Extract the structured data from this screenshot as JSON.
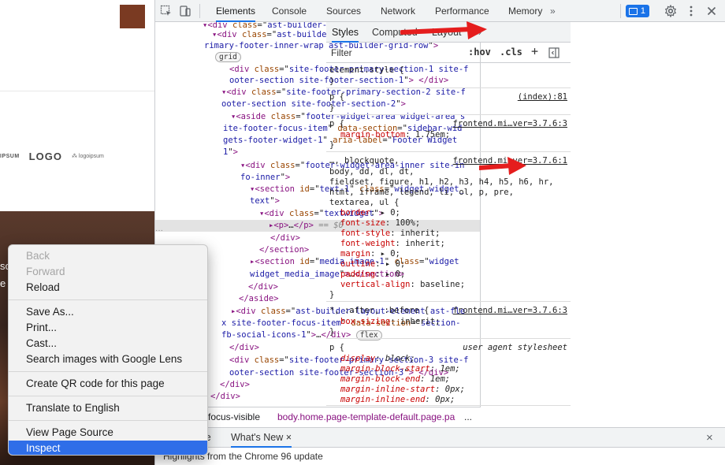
{
  "webpage": {
    "logos": [
      "IPSUM",
      "LOGO",
      "logoipsum"
    ],
    "photo_snippets": [
      "so",
      "e"
    ]
  },
  "context_menu": {
    "groups": [
      [
        {
          "label": "Back",
          "disabled": true
        },
        {
          "label": "Forward",
          "disabled": true
        },
        {
          "label": "Reload"
        }
      ],
      [
        {
          "label": "Save As..."
        },
        {
          "label": "Print..."
        },
        {
          "label": "Cast..."
        },
        {
          "label": "Search images with Google Lens"
        }
      ],
      [
        {
          "label": "Create QR code for this page"
        }
      ],
      [
        {
          "label": "Translate to English"
        }
      ],
      [
        {
          "label": "View Page Source"
        },
        {
          "label": "Inspect",
          "active": true
        }
      ]
    ]
  },
  "devtools": {
    "tabs": [
      "Elements",
      "Console",
      "Sources",
      "Network",
      "Performance",
      "Memory"
    ],
    "more_tabs": "»",
    "issues_count": "1",
    "elements_lines": [
      "<span class='tag'>▾&lt;div</span> <span class='an'>class</span>=\"<span class='av'>ast-builder-grid-row-container-inner</span>\"",
      "<span class='tag'>▾&lt;div</span> <span class='an'>class</span>=\"<span class='av'>ast-builder-footer-grid-columns site-</span>",
      "<span class='av'>rimary-footer-inner-wrap ast-builder-grid-row</span>\"<span class='tag'>&gt;</span>",
      "<span class='pill'>grid</span>",
      "<span class='tag'>&lt;div</span> <span class='an'>class</span>=\"<span class='av'>site-footer-primary-section-1 site-f</span>",
      "<span class='av'>ooter-section site-footer-section-1</span>\"<span class='tag'>&gt;</span> <span class='tag'>&lt;/div&gt;</span>",
      "<span class='tag'>▾&lt;div</span> <span class='an'>class</span>=\"<span class='av'>site-footer-primary-section-2 site-f</span>",
      "<span class='av'>ooter-section site-footer-section-2</span>\"<span class='tag'>&gt;</span>",
      "<span class='tag'>▾&lt;aside</span> <span class='an'>class</span>=\"<span class='av'>footer-widget-area widget-area s</span>",
      "<span class='av'>ite-footer-focus-item</span>\" <span class='an'>data-section</span>=\"<span class='av'>sidebar-wid</span>",
      "<span class='av'>gets-footer-widget-1</span>\" <span class='an'>aria-label</span>=\"<span class='av'>Footer Widget</span>",
      "<span class='av'>1</span>\"<span class='tag'>&gt;</span>",
      "<span class='tag'>▾&lt;div</span> <span class='an'>class</span>=\"<span class='av'>footer-widget-area-inner site-in</span>",
      "<span class='av'>fo-inner</span>\"<span class='tag'>&gt;</span>",
      "<span class='tag'>▾&lt;section</span> <span class='an'>id</span>=\"<span class='av'>text-1</span>\" <span class='an'>class</span>=\"<span class='av'>widget widget_</span>",
      "<span class='av'>text</span>\"<span class='tag'>&gt;</span>",
      "<span class='tag'>▾&lt;div</span> <span class='an'>class</span>=\"<span class='av'>textwidget</span>\"<span class='tag'>&gt;</span>",
      "<span class='tag'>▸&lt;p&gt;</span>…<span class='tag'>&lt;/p&gt;</span> <span class='dim'>==</span> <span class='dim ital'>$0</span>",
      "<span class='tag'>&lt;/div&gt;</span>",
      "<span class='tag'>&lt;/section&gt;</span>",
      "<span class='tag'>▸&lt;section</span> <span class='an'>id</span>=\"<span class='av'>media_image-1</span>\" <span class='an'>class</span>=\"<span class='av'>widget</span>",
      "<span class='av'>widget_media_image</span>\"<span class='tag'>&gt;</span>…<span class='tag'>&lt;/section&gt;</span>",
      "<span class='tag'>&lt;/div&gt;</span>",
      "<span class='tag'>&lt;/aside&gt;</span>",
      "<span class='tag'>▸&lt;div</span> <span class='an'>class</span>=\"<span class='av'>ast-builder-layout-element ast-fle</span>",
      "<span class='av'>x site-footer-focus-item</span>\" <span class='an'>data-section</span>=\"<span class='av'>section-</span>",
      "<span class='av'>fb-social-icons-1</span>\"<span class='tag'>&gt;</span>…<span class='tag'>&lt;/div&gt;</span> <span class='pill'>flex</span>",
      "<span class='tag'>&lt;/div&gt;</span>",
      "<span class='tag'>&lt;div</span> <span class='an'>class</span>=\"<span class='av'>site-footer-primary-section-3 site-f</span>",
      "<span class='av'>ooter-section site-footer-section-3</span>\"<span class='tag'>&gt;</span> <span class='tag'>&lt;/div&gt;</span>",
      "<span class='tag'>&lt;/div&gt;</span>",
      "<span class='tag'>&lt;/div&gt;</span>"
    ],
    "breadcrumbs": [
      "-focus-visible",
      "body.home.page-template-default.page.pa",
      "..."
    ],
    "styles_tabs": [
      "Styles",
      "Computed",
      "Layout",
      "»"
    ],
    "filter_placeholder": "Filter",
    "filter_buttons": [
      ":hov",
      ".cls",
      "+"
    ],
    "rules": [
      {
        "lines": [
          "element.style {",
          "}"
        ]
      },
      {
        "selector": "p {",
        "source": "(index):81",
        "lines": [
          "}"
        ]
      },
      {
        "selector": "p {",
        "source": "frontend.mi…ver=3.7.6:3",
        "decls": [
          [
            "margin-bottom",
            "1.75em;"
          ]
        ],
        "close": "}"
      },
      {
        "selector": "…, blockquote,",
        "source": "frontend.mi…ver=3.7.6:1",
        "sel_lines": [
          "body, dd, dl, dt,",
          "fieldset, figure, h1, h2, h3, h4, h5, h6, hr,",
          "html, iframe, legend, li, ol, p, pre,",
          "textarea, ul {"
        ],
        "decls": [
          [
            "border",
            "▸ 0;"
          ],
          [
            "font-size",
            "100%;"
          ],
          [
            "font-style",
            "inherit;"
          ],
          [
            "font-weight",
            "inherit;"
          ],
          [
            "margin",
            "▸ 0;"
          ],
          [
            "outline",
            "▸ 0;"
          ],
          [
            "padding",
            "▸ 0;"
          ],
          [
            "vertical-align",
            "baseline;"
          ]
        ],
        "close": "}"
      },
      {
        "selector": "*, :after, :before {",
        "source": "frontend.mi…ver=3.7.6:3",
        "decls": [
          [
            "box-sizing",
            "inherit;"
          ]
        ],
        "close": "}"
      },
      {
        "selector": "p {",
        "source": "user agent stylesheet",
        "decls": [
          [
            "display",
            "block;"
          ],
          [
            "margin-block-start",
            "1em;"
          ],
          [
            "margin-block-end",
            "1em;"
          ],
          [
            "margin-inline-start",
            "0px;"
          ],
          [
            "margin-inline-end",
            "0px;"
          ]
        ]
      }
    ],
    "drawer_tabs": [
      "le",
      "What's New ×"
    ],
    "drawer_close": "×",
    "drawer_text": "Highlights from the Chrome 96 update"
  },
  "colors": {
    "accent": "#1a73e8",
    "arrow": "#e51d1d",
    "menu_active": "#2f6ee8"
  }
}
